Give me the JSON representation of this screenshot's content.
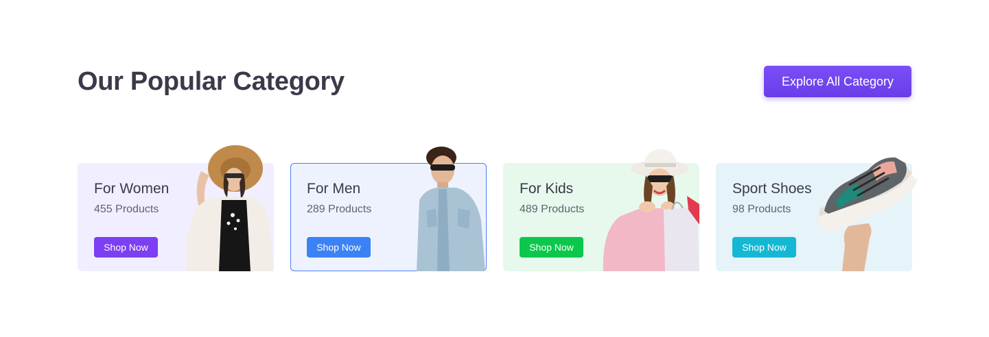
{
  "header": {
    "title": "Our Popular Category",
    "explore_label": "Explore All Category"
  },
  "categories": [
    {
      "title": "For Women",
      "count": "455 Products",
      "button": "Shop Now",
      "accent": "#7c3ff2",
      "bg": "#f1eeff",
      "image": "woman-with-hat-photo"
    },
    {
      "title": "For Men",
      "count": "289 Products",
      "button": "Shop Now",
      "accent": "#3b82f6",
      "bg": "#eef2ff",
      "image": "man-denim-jacket-photo"
    },
    {
      "title": "For Kids",
      "count": "489 Products",
      "button": "Shop Now",
      "accent": "#0bc84b",
      "bg": "#e6f9ec",
      "image": "girl-shopping-bag-photo"
    },
    {
      "title": "Sport Shoes",
      "count": "98 Products",
      "button": "Shop Now",
      "accent": "#14b8d4",
      "bg": "#e6f3f8",
      "image": "sneaker-in-hand-photo"
    }
  ],
  "colors": {
    "primary": "#6a3de8",
    "heading": "#3a3a4a",
    "muted": "#5f6270"
  }
}
